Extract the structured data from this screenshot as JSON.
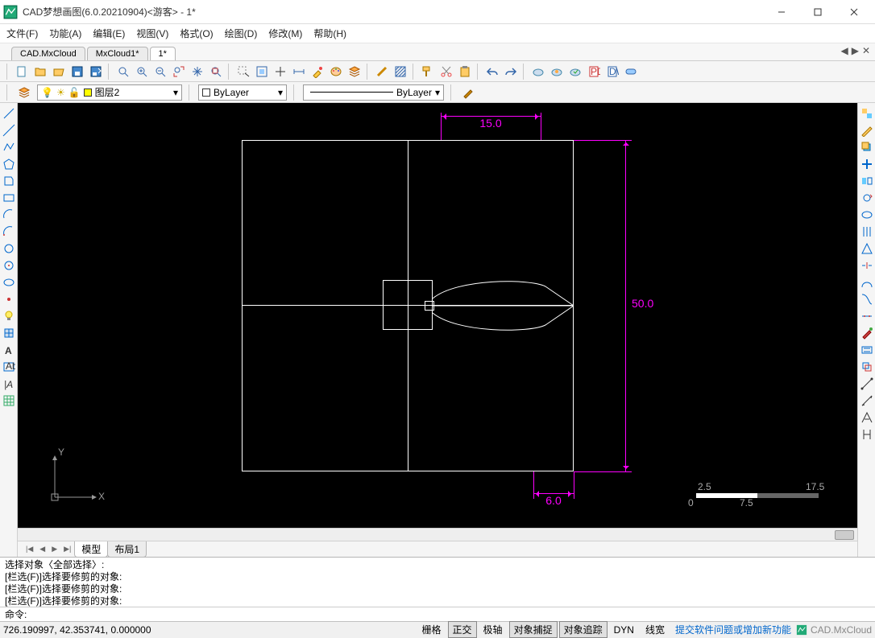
{
  "title": "CAD梦想画图(6.0.20210904)<游客> - 1*",
  "menu": [
    "文件(F)",
    "功能(A)",
    "编辑(E)",
    "视图(V)",
    "格式(O)",
    "绘图(D)",
    "修改(M)",
    "帮助(H)"
  ],
  "doc_tabs": [
    {
      "label": "CAD.MxCloud",
      "active": false
    },
    {
      "label": "MxCloud1*",
      "active": false
    },
    {
      "label": "1*",
      "active": true
    }
  ],
  "layer": {
    "current": "图层2"
  },
  "color": {
    "current": "ByLayer"
  },
  "linetype": {
    "current": "ByLayer"
  },
  "dimensions": {
    "top": "15.0",
    "right": "50.0",
    "bottom": "6.0"
  },
  "scale": {
    "left": "0",
    "right": "17.5",
    "mid_top": "2.5",
    "mid_bot": "7.5"
  },
  "ucs": {
    "x": "X",
    "y": "Y"
  },
  "view_tabs": [
    {
      "label": "模型",
      "active": true
    },
    {
      "label": "布局1",
      "active": false
    }
  ],
  "cmdlog_lines": [
    "选择对象〈全部选择〉:",
    "[栏选(F)]选择要修剪的对象:",
    "[栏选(F)]选择要修剪的对象:",
    "[栏选(F)]选择要修剪的对象:"
  ],
  "cmd_prompt": "命令:",
  "status": {
    "coords": "726.190997,  42.353741,  0.000000",
    "snapgrid": "栅格",
    "ortho": "正交",
    "polar": "极轴",
    "osnap": "对象捕捉",
    "otrack": "对象追踪",
    "dyn": "DYN",
    "lwt": "线宽",
    "feedback": "提交软件问题或增加新功能",
    "brand": "CAD.MxCloud"
  },
  "toolbar_icons": [
    "new",
    "open",
    "openfolder",
    "save",
    "saveas",
    "zoom",
    "zoomin",
    "zoomout",
    "zoomext",
    "pan",
    "zoomwin",
    "select",
    "selectall",
    "pick",
    "dist",
    "paint",
    "palette",
    "layers",
    "props",
    "hatch",
    "copyfmt",
    "cut",
    "paste",
    "undo",
    "redo",
    "cloud1",
    "cloud2",
    "cloud3",
    "pdf",
    "dwg",
    "toggle"
  ],
  "left_tools": [
    "line",
    "xline",
    "pline",
    "polygon",
    "rect",
    "rect2",
    "arc",
    "arc2",
    "circle",
    "circle2",
    "ellipse",
    "spot",
    "bulb",
    "block",
    "textA",
    "mtext",
    "textA2",
    "grid"
  ],
  "right_tools": [
    "layprop",
    "layiso",
    "layers2",
    "layer3",
    "layer4",
    "roll",
    "vline",
    "vline2",
    "vline3",
    "arc3",
    "arc4",
    "div",
    "brush",
    "rect3",
    "rect4",
    "dim1",
    "dim2",
    "dimA",
    "dimH"
  ]
}
